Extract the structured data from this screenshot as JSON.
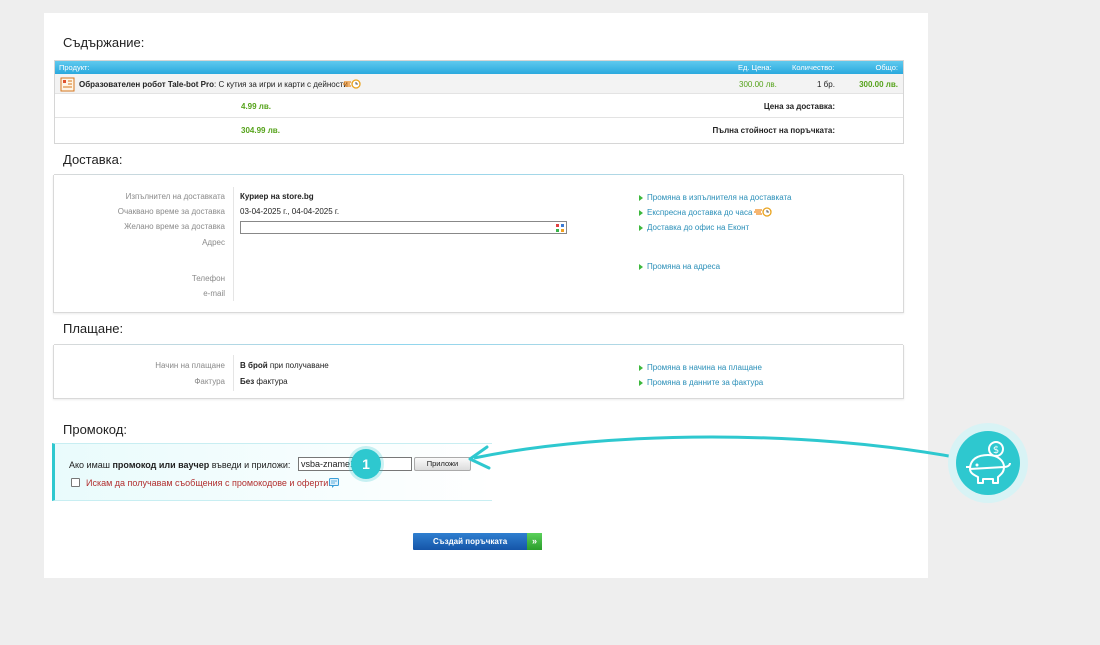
{
  "content": {
    "title": "Съдържание:",
    "headers": {
      "product": "Продукт:",
      "unit_price": "Ед. Цена:",
      "quantity": "Количество:",
      "total": "Общо:"
    },
    "item": {
      "name": "Образователен робот Tale-bot Pro",
      "desc": ": С кутия за игри и карти с дейности",
      "price": "300.00 лв.",
      "qty": "1 бр.",
      "total": "300.00 лв."
    },
    "delivery_price_label": "Цена за доставка:",
    "delivery_price": "4.99 лв.",
    "order_total_label": "Пълна стойност на поръчката:",
    "order_total": "304.99 лв."
  },
  "delivery": {
    "title": "Доставка:",
    "labels": {
      "carrier": "Изпълнител на доставката",
      "expected": "Очаквано време за доставка",
      "desired": "Желано време за доставка",
      "address": "Адрес",
      "phone": "Телефон",
      "email": "e-mail"
    },
    "carrier": "Куриер на store.bg",
    "expected": "03-04-2025 г., 04-04-2025 г.",
    "desired_value": "",
    "links": {
      "change_carrier": "Промяна в изпълнителя на доставката",
      "express": "Експресна доставка до часа",
      "office": "Доставка до офис на Еконт",
      "change_address": "Промяна на адреса"
    }
  },
  "payment": {
    "title": "Плащане:",
    "labels": {
      "method": "Начин на плащане",
      "invoice": "Фактура"
    },
    "method_bold": "В брой",
    "method_rest": " при получаване",
    "invoice_bold": "Без",
    "invoice_rest": " фактура",
    "links": {
      "change_method": "Промяна в начина на плащане",
      "change_invoice": "Промяна в данните за фактура"
    }
  },
  "promo": {
    "title": "Промокод:",
    "text_pre": "Ако имаш ",
    "text_bold": "промокод или ваучер",
    "text_post": " въведи и приложи:",
    "code_value": "vsba-zname1",
    "apply_label": "Приложи",
    "subscribe_label": "Искам да получавам съобщения с промокодове и оферти.",
    "subscribe_checked": false
  },
  "annotation": {
    "step_number": "1",
    "accent_color": "#2ec8cf"
  },
  "create_order_label": "Създай поръчката"
}
